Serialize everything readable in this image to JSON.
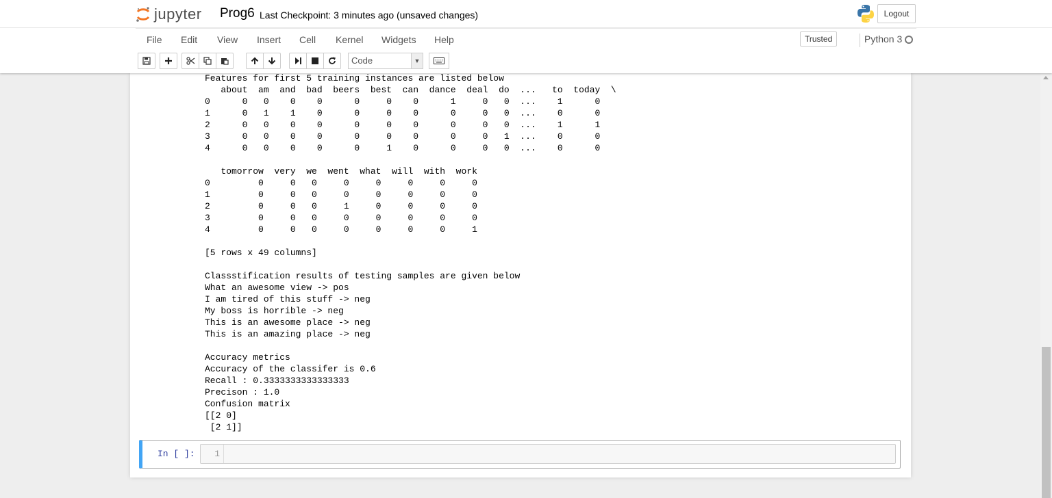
{
  "header": {
    "logo_text": "jupyter",
    "notebook_name": "Prog6",
    "checkpoint": "Last Checkpoint: 3 minutes ago (unsaved changes)",
    "logout_label": "Logout"
  },
  "menu": {
    "items": [
      "File",
      "Edit",
      "View",
      "Insert",
      "Cell",
      "Kernel",
      "Widgets",
      "Help"
    ],
    "trusted_label": "Trusted",
    "kernel_name": "Python 3"
  },
  "toolbar": {
    "cell_type": "Code",
    "buttons": [
      "save-icon",
      "plus-icon",
      "scissors-icon",
      "copy-icon",
      "paste-icon",
      "arrow-up-icon",
      "arrow-down-icon",
      "step-forward-icon",
      "stop-icon",
      "refresh-icon",
      "keyboard-icon"
    ]
  },
  "output": {
    "text": "Features for first 5 training instances are listed below\n   about  am  and  bad  beers  best  can  dance  deal  do  ...   to  today  \\\n0      0   0    0    0      0     0    0      1     0   0  ...    1      0   \n1      0   1    1    0      0     0    0      0     0   0  ...    0      0   \n2      0   0    0    0      0     0    0      0     0   0  ...    1      1   \n3      0   0    0    0      0     0    0      0     0   1  ...    0      0   \n4      0   0    0    0      0     1    0      0     0   0  ...    0      0   \n\n   tomorrow  very  we  went  what  will  with  work  \n0         0     0   0     0     0     0     0     0  \n1         0     0   0     0     0     0     0     0  \n2         0     0   0     1     0     0     0     0  \n3         0     0   0     0     0     0     0     0  \n4         0     0   0     0     0     0     0     1  \n\n[5 rows x 49 columns]\n\nClassstification results of testing samples are given below\nWhat an awesome view -> pos\nI am tired of this stuff -> neg\nMy boss is horrible -> neg\nThis is an awesome place -> neg\nThis is an amazing place -> neg\n\nAccuracy metrics\nAccuracy of the classifer is 0.6\nRecall : 0.3333333333333333\nPrecison : 1.0\nConfusion matrix\n[[2 0]\n [2 1]]"
  },
  "input_cell": {
    "prompt": "In [ ]:",
    "line_number": "1"
  },
  "colors": {
    "cell_selected_border": "#42a5f5",
    "prompt_color": "#303f9f"
  }
}
